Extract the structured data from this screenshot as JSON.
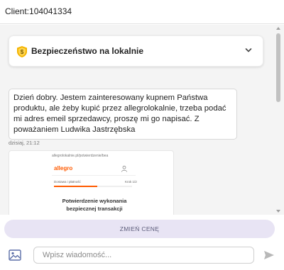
{
  "header": {
    "title": "Client:104041334"
  },
  "safety_card": {
    "label": "Bezpieczeństwo na lokalnie",
    "icon": "shield-icon",
    "accent": "#f4b400"
  },
  "messages": [
    {
      "text": "Dzień dobry. Jestem zainteresowany kupnem Państwa produktu, ale żeby kupić przez allegrolokalnie, trzeba podać mi adres emeil sprzedawcy, proszę mi go napisać. Z poważaniem Ludwika Jastrzębska",
      "timestamp": "dzisiaj, 21:12"
    }
  ],
  "image_message": {
    "url": "allegrolokalnie.pl/potwierdzenie/bea",
    "logo": "allegro",
    "step_label": "Dostawa i płatność",
    "step_time": "Krok 1/2",
    "progress": 0.55,
    "heading": "Potwierdzenie wykonania bezpiecznej transakcji",
    "accent": "#ff5a00"
  },
  "actions": {
    "change_price": "ZMIEŃ CENĘ"
  },
  "composer": {
    "placeholder": "Wpisz wiadomość...",
    "value": ""
  }
}
